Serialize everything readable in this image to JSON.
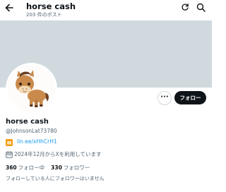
{
  "header": {
    "back_icon": "arrow-left-icon",
    "title": "horse cash",
    "post_count": "203 件のポスト",
    "refresh_icon": "refresh-icon",
    "search_icon": "search-icon"
  },
  "banner": {
    "color": "#cfd9de"
  },
  "profile": {
    "avatar_icon": "horse-avatar-illustration",
    "more_label": "···",
    "follow_label": "フォロー",
    "name": "horse cash",
    "handle": "@JohnsonLat73780",
    "link_icon": "link-badge-icon",
    "link": "lin.ee/xHhCrH1",
    "calendar_icon": "calendar-icon",
    "joined": "2024年12月からXを利用しています",
    "following_count": "360",
    "following_label": "フォロー中",
    "followers_count": "330",
    "followers_label": "フォロワー",
    "mutual_notice": "フォローしている人にフォロワーはいません"
  },
  "colors": {
    "accent": "#1d9bf0",
    "text": "#0f1419",
    "muted": "#536471",
    "follow_bg": "#0f1419",
    "link_badge": "#f39c12"
  }
}
